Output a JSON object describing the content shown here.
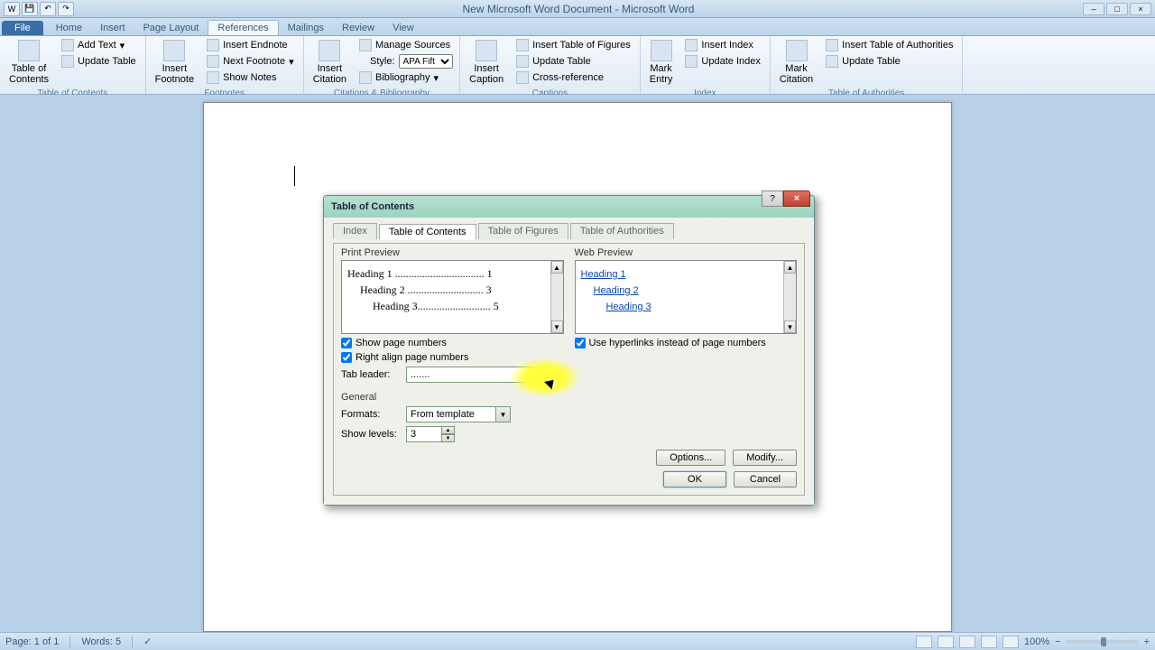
{
  "window": {
    "title": "New Microsoft Word Document - Microsoft Word"
  },
  "ribbon_tabs": {
    "file": "File",
    "home": "Home",
    "insert": "Insert",
    "page_layout": "Page Layout",
    "references": "References",
    "mailings": "Mailings",
    "review": "Review",
    "view": "View"
  },
  "ribbon": {
    "toc": {
      "main": "Table of\nContents",
      "add_text": "Add Text",
      "update": "Update Table",
      "group": "Table of Contents"
    },
    "footnotes": {
      "insert": "Insert\nFootnote",
      "endnote": "Insert Endnote",
      "next": "Next Footnote",
      "show": "Show Notes",
      "group": "Footnotes"
    },
    "citations": {
      "insert": "Insert\nCitation",
      "manage": "Manage Sources",
      "style_label": "Style:",
      "style_value": "APA Fift",
      "biblio": "Bibliography",
      "group": "Citations & Bibliography"
    },
    "captions": {
      "insert": "Insert\nCaption",
      "figures": "Insert Table of Figures",
      "update": "Update Table",
      "cross": "Cross-reference",
      "group": "Captions"
    },
    "index": {
      "mark": "Mark\nEntry",
      "insert": "Insert Index",
      "update": "Update Index",
      "group": "Index"
    },
    "authorities": {
      "mark": "Mark\nCitation",
      "insert": "Insert Table of Authorities",
      "update": "Update Table",
      "group": "Table of Authorities"
    }
  },
  "dialog": {
    "title": "Table of Contents",
    "tabs": {
      "index": "Index",
      "toc": "Table of Contents",
      "figures": "Table of Figures",
      "authorities": "Table of Authorities"
    },
    "print_preview": {
      "label": "Print Preview",
      "line1": "Heading 1 ................................. 1",
      "line2": "Heading 2 ............................ 3",
      "line3": "Heading 3........................... 5"
    },
    "web_preview": {
      "label": "Web Preview",
      "h1": "Heading 1",
      "h2": "Heading 2",
      "h3": "Heading 3"
    },
    "show_page_numbers": "Show page numbers",
    "right_align": "Right align page numbers",
    "use_hyperlinks": "Use hyperlinks instead of page numbers",
    "tab_leader_label": "Tab leader:",
    "tab_leader_value": ".......",
    "general": "General",
    "formats_label": "Formats:",
    "formats_value": "From template",
    "show_levels_label": "Show levels:",
    "show_levels_value": "3",
    "options": "Options...",
    "modify": "Modify...",
    "ok": "OK",
    "cancel": "Cancel"
  },
  "statusbar": {
    "page": "Page: 1 of 1",
    "words": "Words: 5",
    "zoom": "100%"
  }
}
